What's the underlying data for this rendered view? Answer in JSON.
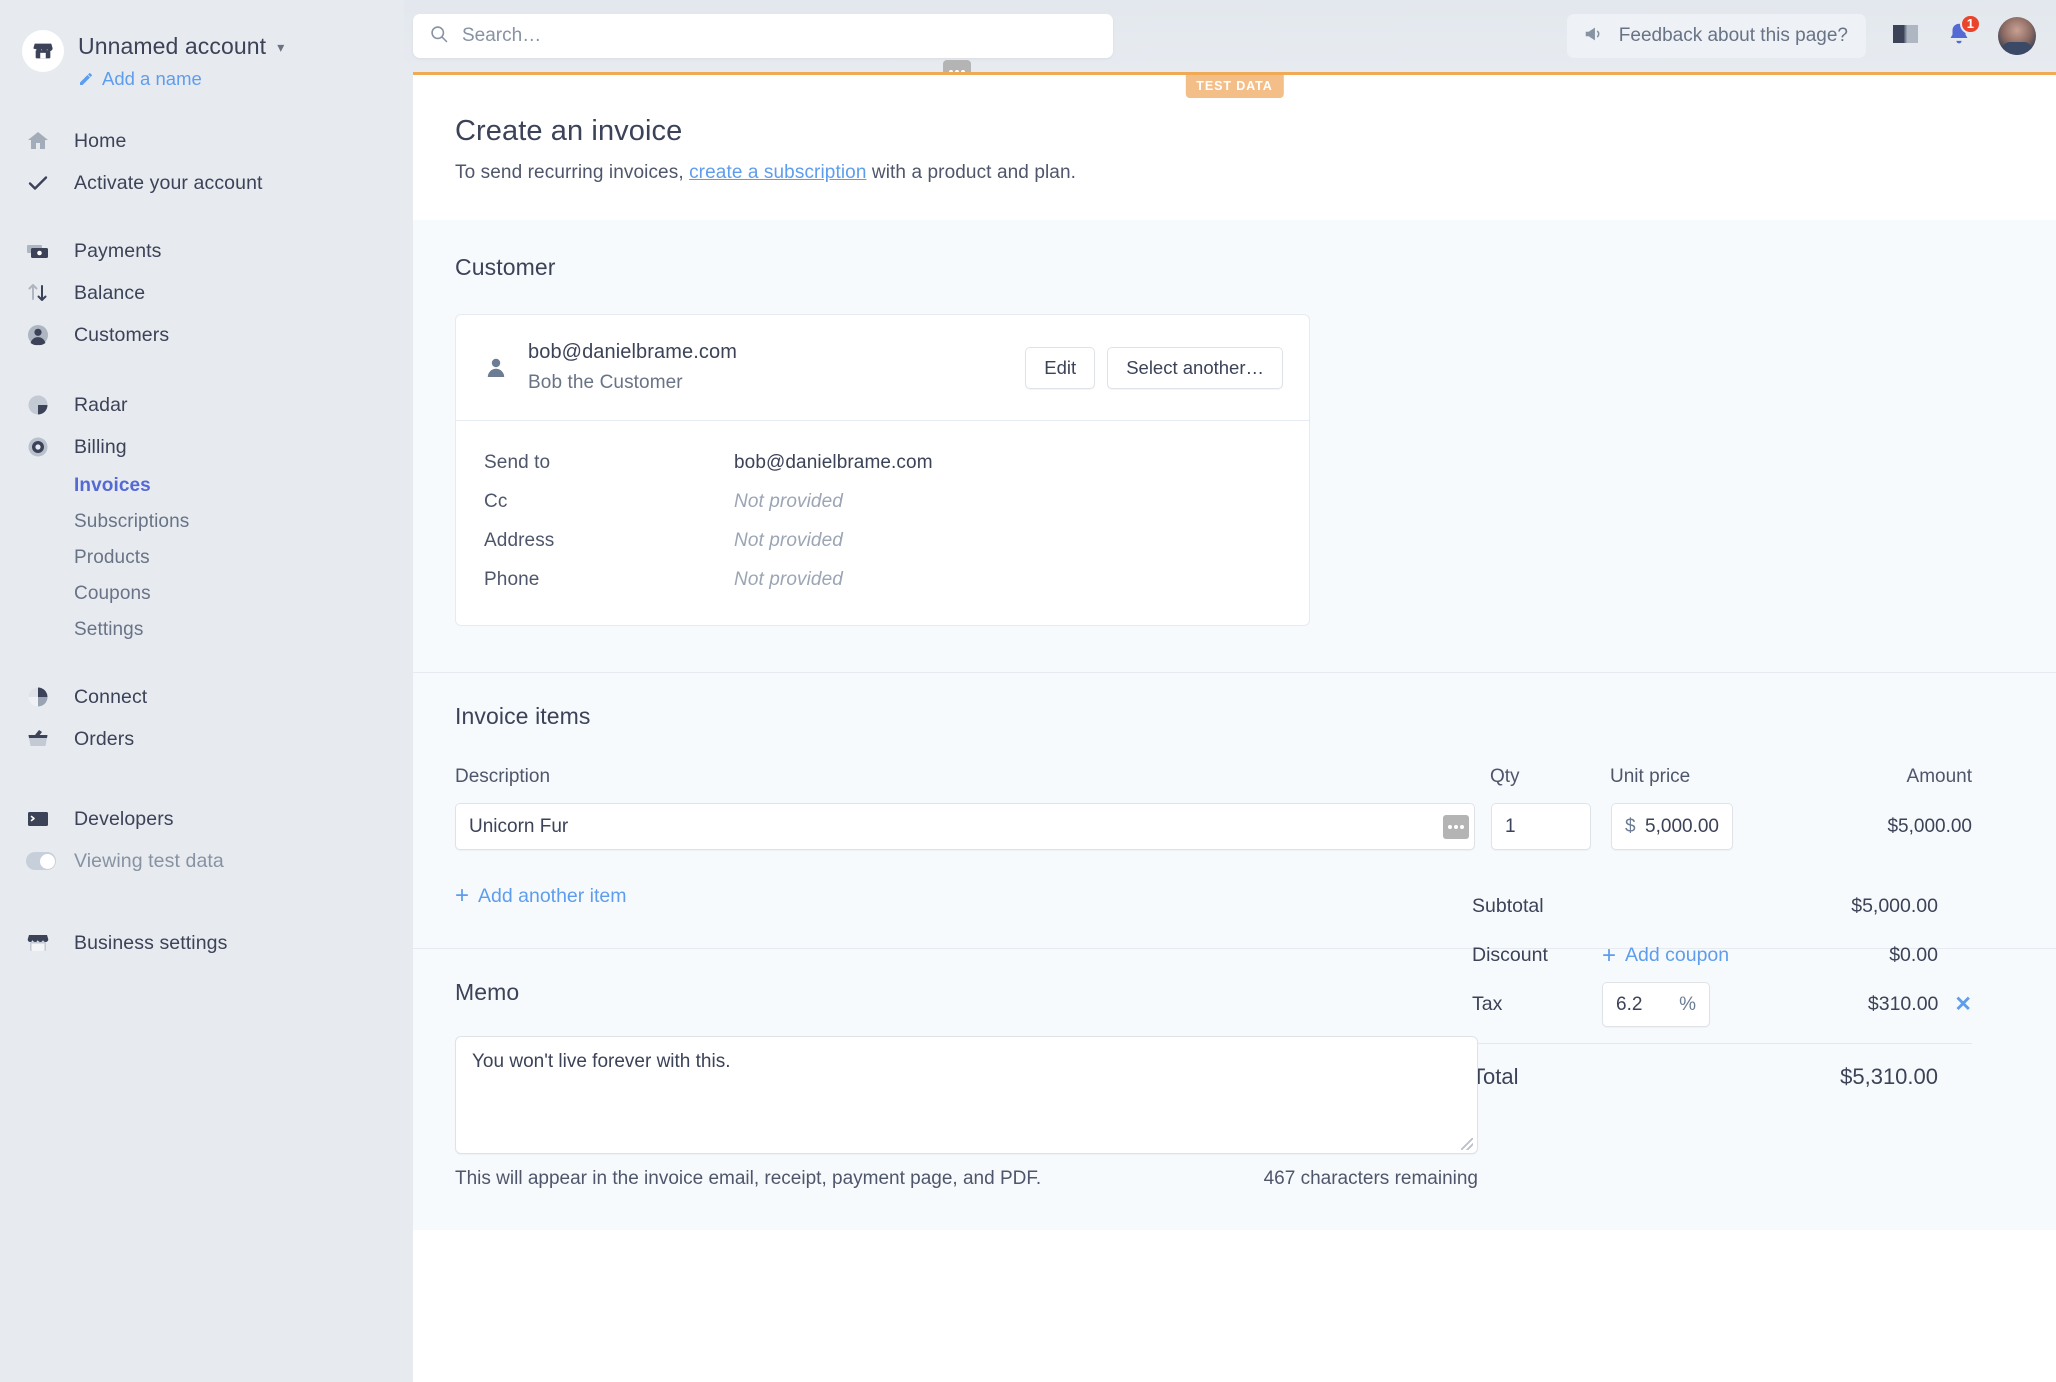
{
  "sidebar": {
    "account_name": "Unnamed account",
    "add_name": "Add a name",
    "primary": [
      {
        "label": "Home",
        "icon": "home-icon"
      },
      {
        "label": "Activate your account",
        "icon": "check-icon"
      }
    ],
    "group_payments": [
      {
        "label": "Payments",
        "icon": "payments-icon"
      },
      {
        "label": "Balance",
        "icon": "balance-icon"
      },
      {
        "label": "Customers",
        "icon": "customers-icon"
      }
    ],
    "group_products": [
      {
        "label": "Radar",
        "icon": "radar-icon"
      },
      {
        "label": "Billing",
        "icon": "billing-icon"
      }
    ],
    "billing_sub": [
      {
        "label": "Invoices",
        "active": true
      },
      {
        "label": "Subscriptions",
        "active": false
      },
      {
        "label": "Products",
        "active": false
      },
      {
        "label": "Coupons",
        "active": false
      },
      {
        "label": "Settings",
        "active": false
      }
    ],
    "group_more": [
      {
        "label": "Connect",
        "icon": "connect-icon"
      },
      {
        "label": "Orders",
        "icon": "orders-icon"
      }
    ],
    "group_dev": [
      {
        "label": "Developers",
        "icon": "developers-icon"
      },
      {
        "label": "Viewing test data",
        "icon": "toggle-icon"
      }
    ],
    "group_settings": [
      {
        "label": "Business settings",
        "icon": "store-icon"
      }
    ]
  },
  "topbar": {
    "search_placeholder": "Search…",
    "feedback_label": "Feedback about this page?",
    "notification_count": "1"
  },
  "page": {
    "test_data_badge": "TEST DATA",
    "title": "Create an invoice",
    "subtitle_before": "To send recurring invoices, ",
    "subtitle_link": "create a subscription",
    "subtitle_after": " with a product and plan."
  },
  "customer": {
    "section_title": "Customer",
    "email": "bob@danielbrame.com",
    "name": "Bob the Customer",
    "edit_label": "Edit",
    "select_another_label": "Select another…",
    "fields": [
      {
        "label": "Send to",
        "value": "bob@danielbrame.com",
        "na": false
      },
      {
        "label": "Cc",
        "value": "Not provided",
        "na": true
      },
      {
        "label": "Address",
        "value": "Not provided",
        "na": true
      },
      {
        "label": "Phone",
        "value": "Not provided",
        "na": true
      }
    ]
  },
  "items": {
    "section_title": "Invoice items",
    "columns": {
      "description": "Description",
      "qty": "Qty",
      "unit_price": "Unit price",
      "amount": "Amount"
    },
    "rows": [
      {
        "description": "Unicorn Fur",
        "qty": "1",
        "currency_symbol": "$",
        "unit_price": "5,000.00",
        "amount": "$5,000.00"
      }
    ],
    "add_another_label": "Add another item",
    "plus_glyph": "+"
  },
  "totals": {
    "subtotal_label": "Subtotal",
    "subtotal_value": "$5,000.00",
    "discount_label": "Discount",
    "add_coupon_label": "Add coupon",
    "discount_value": "$0.00",
    "tax_label": "Tax",
    "tax_rate": "6.2",
    "tax_percent_symbol": "%",
    "tax_value": "$310.00",
    "tax_remove_glyph": "✕",
    "total_label": "Total",
    "total_value": "$5,310.00"
  },
  "memo": {
    "section_title": "Memo",
    "value": "You won't live forever with this.",
    "hint": "This will appear in the invoice email, receipt, payment page, and PDF.",
    "characters_remaining": "467 characters remaining"
  },
  "colors": {
    "accent_blue": "#5e9ded",
    "active_nav": "#5469d4",
    "test_data_orange": "#f0a955",
    "badge_red": "#e8452c"
  }
}
